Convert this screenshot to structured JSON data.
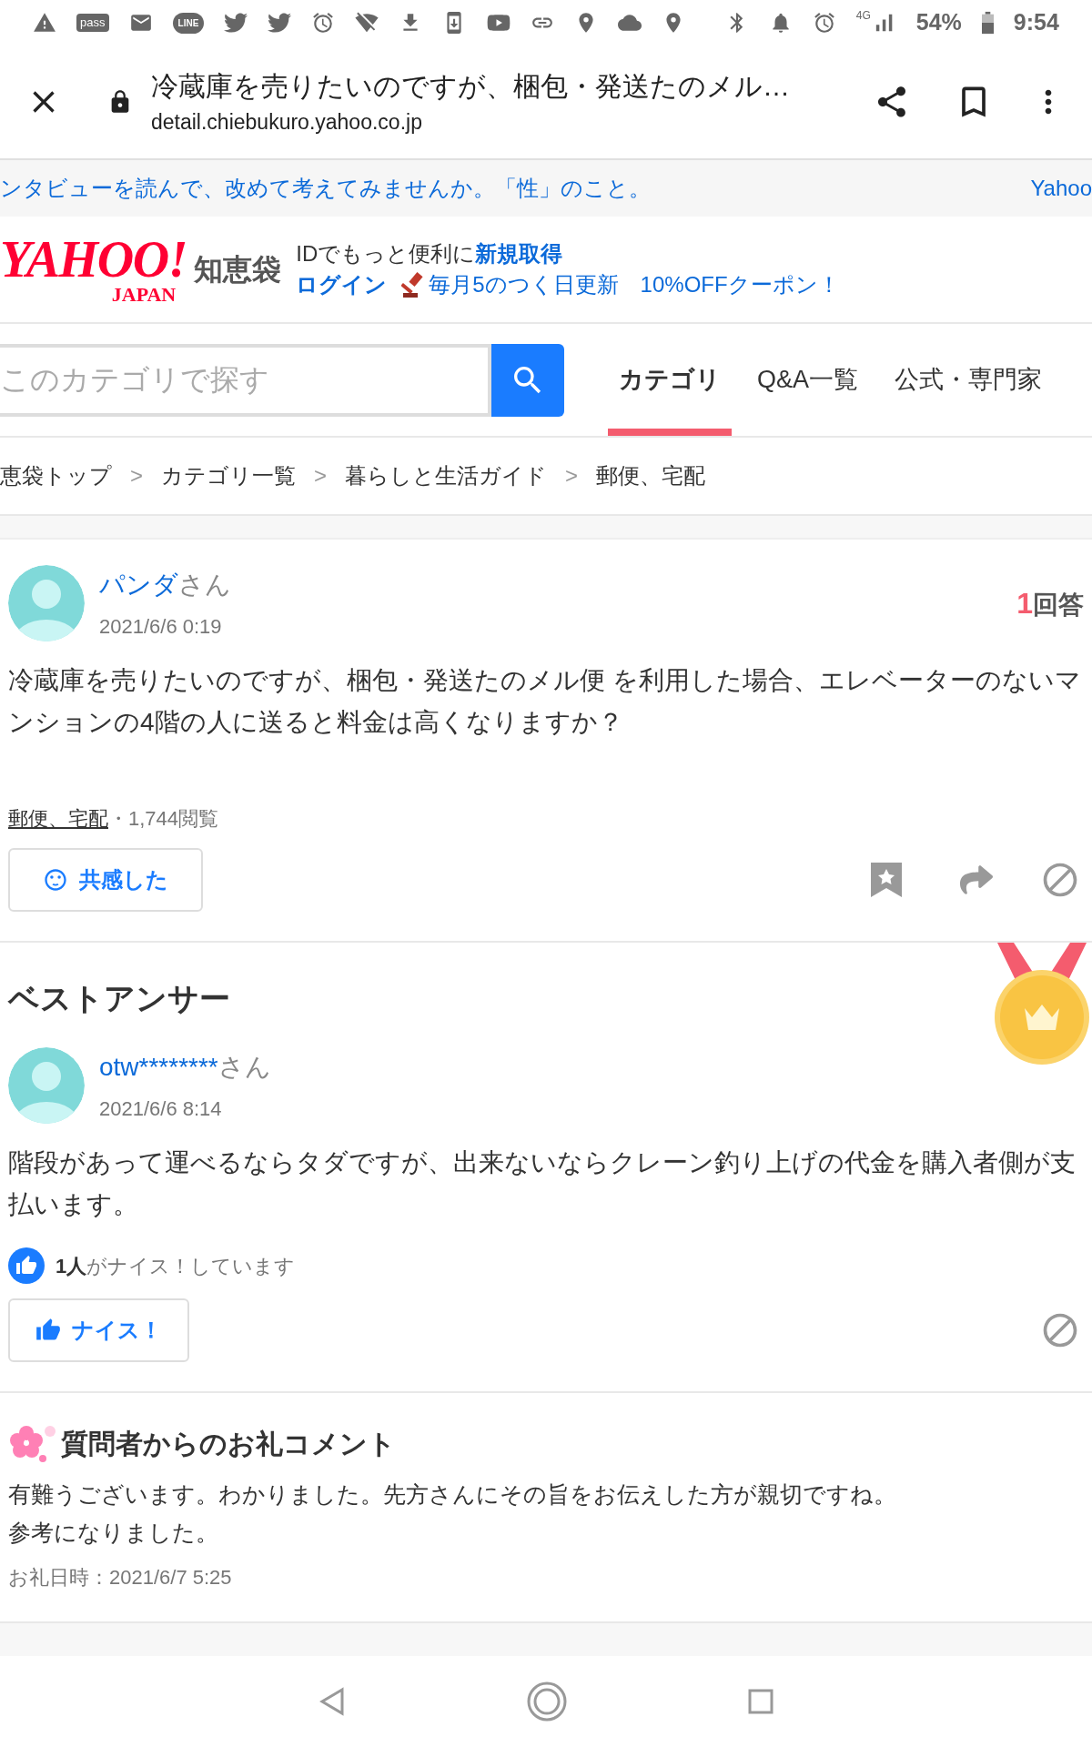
{
  "status_bar": {
    "pass_label": "pass",
    "line_label": "LINE",
    "network": "4G",
    "battery": "54%",
    "time": "9:54"
  },
  "browser": {
    "title": "冷蔵庫を売りたいのですが、梱包・発送たのメル…",
    "url": "detail.chiebukuro.yahoo.co.jp"
  },
  "banner": {
    "text": "ンタビューを読んで、改めて考えてみませんか。「性」のこと。",
    "right": "Yahoo"
  },
  "site_header": {
    "logo": "YAHOO!",
    "logo_sub": "JAPAN",
    "service": "知恵袋",
    "id_prompt": "IDでもっと便利に",
    "signup": "新規取得",
    "login": "ログイン",
    "promo": "毎月5のつく日更新",
    "coupon": "10%OFFクーポン！"
  },
  "search": {
    "placeholder": "このカテゴリで探す"
  },
  "nav_tabs": [
    {
      "label": "カテゴリ",
      "selected": true
    },
    {
      "label": "Q&A一覧",
      "selected": false
    },
    {
      "label": "公式・専門家",
      "selected": false
    }
  ],
  "breadcrumb": {
    "separator": ">",
    "items": [
      "恵袋トップ",
      "カテゴリ一覧",
      "暮らしと生活ガイド",
      "郵便、宅配"
    ]
  },
  "question": {
    "user": "パンダ",
    "honorific": "さん",
    "date": "2021/6/6 0:19",
    "answer_count": "1",
    "answer_unit": "回答",
    "body": "冷蔵庫を売りたいのですが、梱包・発送たのメル便 を利用した場合、エレベーターのないマンションの4階の人に送ると料金は高くなりますか？",
    "category": "郵便、宅配",
    "views": "・1,744閲覧",
    "empathy_button": "共感した"
  },
  "best_answer": {
    "heading": "ベストアンサー",
    "user": "otw********",
    "honorific": "さん",
    "date": "2021/6/6 8:14",
    "body": "階段があって運べるならタダですが、出来ないならクレーン釣り上げの代金を購入者側が支払います。",
    "nice_count": "1人",
    "nice_text": "がナイス！しています",
    "nice_button": "ナイス！"
  },
  "thanks": {
    "heading": "質問者からのお礼コメント",
    "lines": [
      "有難うございます。わかりました。先方さんにその旨をお伝えした方が親切ですね。",
      "参考になりました。"
    ],
    "date": "お礼日時：2021/6/7 5:25"
  }
}
